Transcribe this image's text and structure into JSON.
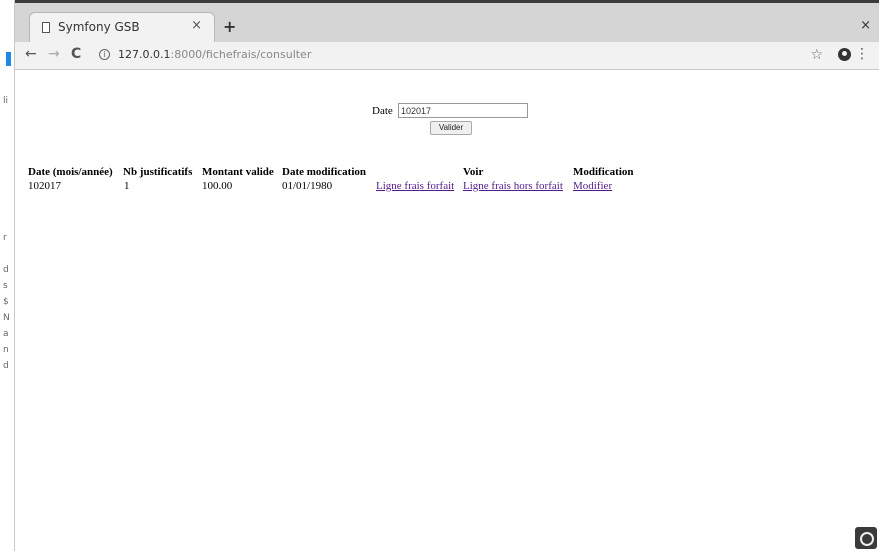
{
  "browser": {
    "tab_title": "Symfony GSB",
    "tab_close": "×",
    "new_tab": "+",
    "window_close": "×",
    "url_host": "127.0.0.1",
    "url_path": ":8000/fichefrais/consulter",
    "nav_back": "←",
    "nav_forward": "→",
    "nav_reload": "C",
    "info": "i",
    "star": "☆",
    "menu": "⋮"
  },
  "behind_window": {
    "chars": [
      "li",
      "r",
      "d",
      "s",
      "$",
      "N",
      "a",
      "n",
      "d"
    ]
  },
  "form": {
    "date_label": "Date",
    "date_value": "102017",
    "submit_label": "Valider"
  },
  "table": {
    "headers": {
      "date": "Date (mois/année)",
      "nb": "Nb justificatifs",
      "montant": "Montant valide",
      "date_modif": "Date modification",
      "voir": "Voir",
      "modification": "Modification"
    },
    "rows": [
      {
        "date": "102017",
        "nb": "1",
        "montant": "100.00",
        "date_modif": "01/01/1980",
        "link_forfait": "Ligne frais forfait",
        "link_hors_forfait": "Ligne frais hors forfait",
        "link_modifier": "Modifier"
      }
    ]
  }
}
